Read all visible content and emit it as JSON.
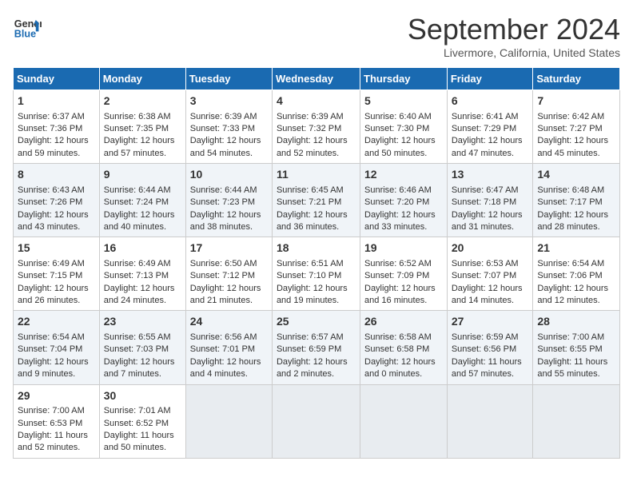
{
  "logo": {
    "line1": "General",
    "line2": "Blue"
  },
  "title": "September 2024",
  "subtitle": "Livermore, California, United States",
  "days_of_week": [
    "Sunday",
    "Monday",
    "Tuesday",
    "Wednesday",
    "Thursday",
    "Friday",
    "Saturday"
  ],
  "weeks": [
    [
      {
        "num": "1",
        "sunrise": "Sunrise: 6:37 AM",
        "sunset": "Sunset: 7:36 PM",
        "daylight": "Daylight: 12 hours and 59 minutes."
      },
      {
        "num": "2",
        "sunrise": "Sunrise: 6:38 AM",
        "sunset": "Sunset: 7:35 PM",
        "daylight": "Daylight: 12 hours and 57 minutes."
      },
      {
        "num": "3",
        "sunrise": "Sunrise: 6:39 AM",
        "sunset": "Sunset: 7:33 PM",
        "daylight": "Daylight: 12 hours and 54 minutes."
      },
      {
        "num": "4",
        "sunrise": "Sunrise: 6:39 AM",
        "sunset": "Sunset: 7:32 PM",
        "daylight": "Daylight: 12 hours and 52 minutes."
      },
      {
        "num": "5",
        "sunrise": "Sunrise: 6:40 AM",
        "sunset": "Sunset: 7:30 PM",
        "daylight": "Daylight: 12 hours and 50 minutes."
      },
      {
        "num": "6",
        "sunrise": "Sunrise: 6:41 AM",
        "sunset": "Sunset: 7:29 PM",
        "daylight": "Daylight: 12 hours and 47 minutes."
      },
      {
        "num": "7",
        "sunrise": "Sunrise: 6:42 AM",
        "sunset": "Sunset: 7:27 PM",
        "daylight": "Daylight: 12 hours and 45 minutes."
      }
    ],
    [
      {
        "num": "8",
        "sunrise": "Sunrise: 6:43 AM",
        "sunset": "Sunset: 7:26 PM",
        "daylight": "Daylight: 12 hours and 43 minutes."
      },
      {
        "num": "9",
        "sunrise": "Sunrise: 6:44 AM",
        "sunset": "Sunset: 7:24 PM",
        "daylight": "Daylight: 12 hours and 40 minutes."
      },
      {
        "num": "10",
        "sunrise": "Sunrise: 6:44 AM",
        "sunset": "Sunset: 7:23 PM",
        "daylight": "Daylight: 12 hours and 38 minutes."
      },
      {
        "num": "11",
        "sunrise": "Sunrise: 6:45 AM",
        "sunset": "Sunset: 7:21 PM",
        "daylight": "Daylight: 12 hours and 36 minutes."
      },
      {
        "num": "12",
        "sunrise": "Sunrise: 6:46 AM",
        "sunset": "Sunset: 7:20 PM",
        "daylight": "Daylight: 12 hours and 33 minutes."
      },
      {
        "num": "13",
        "sunrise": "Sunrise: 6:47 AM",
        "sunset": "Sunset: 7:18 PM",
        "daylight": "Daylight: 12 hours and 31 minutes."
      },
      {
        "num": "14",
        "sunrise": "Sunrise: 6:48 AM",
        "sunset": "Sunset: 7:17 PM",
        "daylight": "Daylight: 12 hours and 28 minutes."
      }
    ],
    [
      {
        "num": "15",
        "sunrise": "Sunrise: 6:49 AM",
        "sunset": "Sunset: 7:15 PM",
        "daylight": "Daylight: 12 hours and 26 minutes."
      },
      {
        "num": "16",
        "sunrise": "Sunrise: 6:49 AM",
        "sunset": "Sunset: 7:13 PM",
        "daylight": "Daylight: 12 hours and 24 minutes."
      },
      {
        "num": "17",
        "sunrise": "Sunrise: 6:50 AM",
        "sunset": "Sunset: 7:12 PM",
        "daylight": "Daylight: 12 hours and 21 minutes."
      },
      {
        "num": "18",
        "sunrise": "Sunrise: 6:51 AM",
        "sunset": "Sunset: 7:10 PM",
        "daylight": "Daylight: 12 hours and 19 minutes."
      },
      {
        "num": "19",
        "sunrise": "Sunrise: 6:52 AM",
        "sunset": "Sunset: 7:09 PM",
        "daylight": "Daylight: 12 hours and 16 minutes."
      },
      {
        "num": "20",
        "sunrise": "Sunrise: 6:53 AM",
        "sunset": "Sunset: 7:07 PM",
        "daylight": "Daylight: 12 hours and 14 minutes."
      },
      {
        "num": "21",
        "sunrise": "Sunrise: 6:54 AM",
        "sunset": "Sunset: 7:06 PM",
        "daylight": "Daylight: 12 hours and 12 minutes."
      }
    ],
    [
      {
        "num": "22",
        "sunrise": "Sunrise: 6:54 AM",
        "sunset": "Sunset: 7:04 PM",
        "daylight": "Daylight: 12 hours and 9 minutes."
      },
      {
        "num": "23",
        "sunrise": "Sunrise: 6:55 AM",
        "sunset": "Sunset: 7:03 PM",
        "daylight": "Daylight: 12 hours and 7 minutes."
      },
      {
        "num": "24",
        "sunrise": "Sunrise: 6:56 AM",
        "sunset": "Sunset: 7:01 PM",
        "daylight": "Daylight: 12 hours and 4 minutes."
      },
      {
        "num": "25",
        "sunrise": "Sunrise: 6:57 AM",
        "sunset": "Sunset: 6:59 PM",
        "daylight": "Daylight: 12 hours and 2 minutes."
      },
      {
        "num": "26",
        "sunrise": "Sunrise: 6:58 AM",
        "sunset": "Sunset: 6:58 PM",
        "daylight": "Daylight: 12 hours and 0 minutes."
      },
      {
        "num": "27",
        "sunrise": "Sunrise: 6:59 AM",
        "sunset": "Sunset: 6:56 PM",
        "daylight": "Daylight: 11 hours and 57 minutes."
      },
      {
        "num": "28",
        "sunrise": "Sunrise: 7:00 AM",
        "sunset": "Sunset: 6:55 PM",
        "daylight": "Daylight: 11 hours and 55 minutes."
      }
    ],
    [
      {
        "num": "29",
        "sunrise": "Sunrise: 7:00 AM",
        "sunset": "Sunset: 6:53 PM",
        "daylight": "Daylight: 11 hours and 52 minutes."
      },
      {
        "num": "30",
        "sunrise": "Sunrise: 7:01 AM",
        "sunset": "Sunset: 6:52 PM",
        "daylight": "Daylight: 11 hours and 50 minutes."
      },
      null,
      null,
      null,
      null,
      null
    ]
  ]
}
